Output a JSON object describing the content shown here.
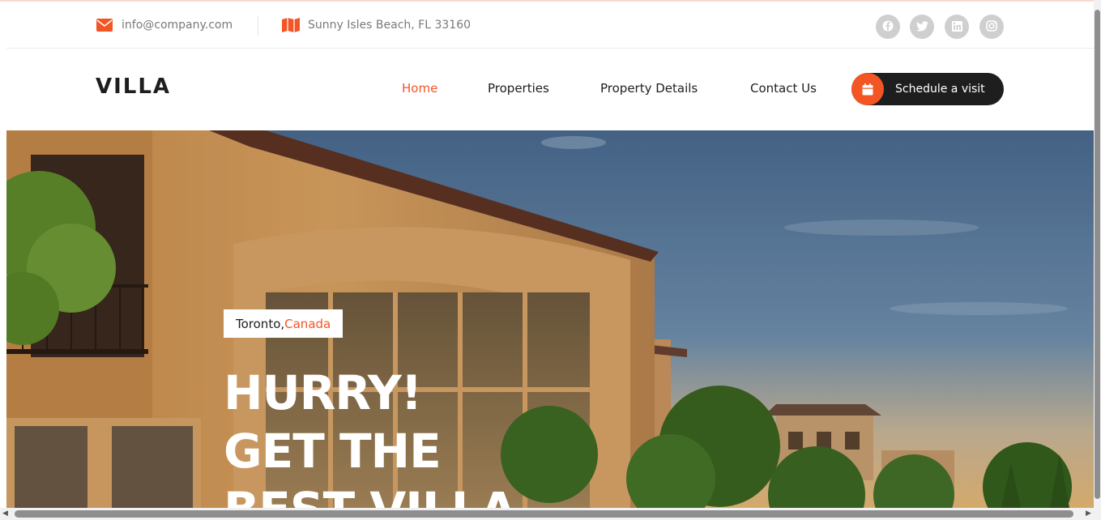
{
  "topbar": {
    "email": "info@company.com",
    "address": "Sunny Isles Beach, FL 33160",
    "icons": {
      "email": "envelope-icon",
      "address": "map-icon",
      "socials": [
        "facebook-icon",
        "twitter-icon",
        "linkedin-icon",
        "instagram-icon"
      ]
    }
  },
  "header": {
    "logo": "VILLA",
    "nav": {
      "home": "Home",
      "properties": "Properties",
      "details": "Property Details",
      "contact": "Contact Us"
    },
    "cta_label": "Schedule a visit",
    "cta_icon": "calendar-icon",
    "active_item": "Home"
  },
  "hero": {
    "location_city": "Toronto, ",
    "location_country": "Canada",
    "title_line1": "HURRY!",
    "title_line2": "GET THE",
    "title_line3": "BEST VILLA"
  },
  "colors": {
    "accent": "#f35525",
    "dark": "#1e1e1e",
    "social_bg": "#cfcfcf"
  }
}
